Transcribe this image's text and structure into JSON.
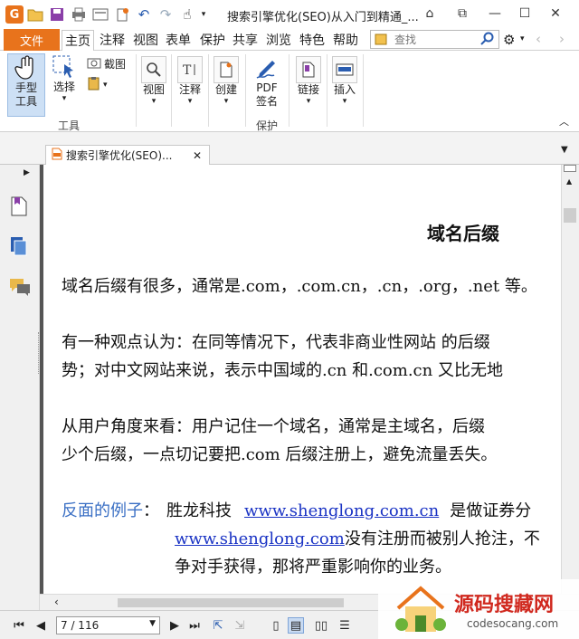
{
  "window": {
    "title": "搜索引擎优化(SEO)从入门到精通_..."
  },
  "menu": {
    "file": "文件",
    "tabs": [
      "主页",
      "注释",
      "视图",
      "表单",
      "保护",
      "共享",
      "浏览",
      "特色",
      "帮助"
    ],
    "active_tab": "主页",
    "search_placeholder": "查找"
  },
  "ribbon": {
    "hand_tool": "手型\n工具",
    "hand_tool_l1": "手型",
    "hand_tool_l2": "工具",
    "select": "选择",
    "snapshot": "截图",
    "tools_group": "工具",
    "view": "视图",
    "annotate": "注释",
    "create": "创建",
    "pdf_sign_l1": "PDF",
    "pdf_sign_l2": "签名",
    "protect_group": "保护",
    "link": "链接",
    "insert": "插入"
  },
  "doc_tab": {
    "label": "搜索引擎优化(SEO)..."
  },
  "document": {
    "heading": "域名后缀",
    "p1": "域名后缀有很多，通常是.com，.com.cn，.cn，.org，.net 等。",
    "p2_l1": "有一种观点认为：在同等情况下，代表非商业性网站  的后缀",
    "p2_l2": "势；对中文网站来说，表示中国域的.cn 和.com.cn 又比无地",
    "p3_l1": "从用户角度来看：用户记住一个域名，通常是主域名，后缀",
    "p3_l2": "少个后缀，一点切记要把.com 后缀注册上，避免流量丢失。",
    "p4_label": "反面的例子",
    "p4_colon": "：",
    "p4_company": "胜龙科技",
    "p4_link1": "www.shenglong.com.cn",
    "p4_after1": "是做证券分",
    "p4_link2": "www.shenglong.com",
    "p4_after2": "没有注册而被别人抢注，不",
    "p4_l3": "争对手获得，那将严重影响你的业务。"
  },
  "navigation": {
    "page_display": "7 / 116"
  },
  "watermark": {
    "brand": "源码搜藏网",
    "url": "codesocang.com"
  },
  "colors": {
    "accent": "#e8731c",
    "link": "#1a33c4",
    "counter_example": "#3a6fc4"
  }
}
